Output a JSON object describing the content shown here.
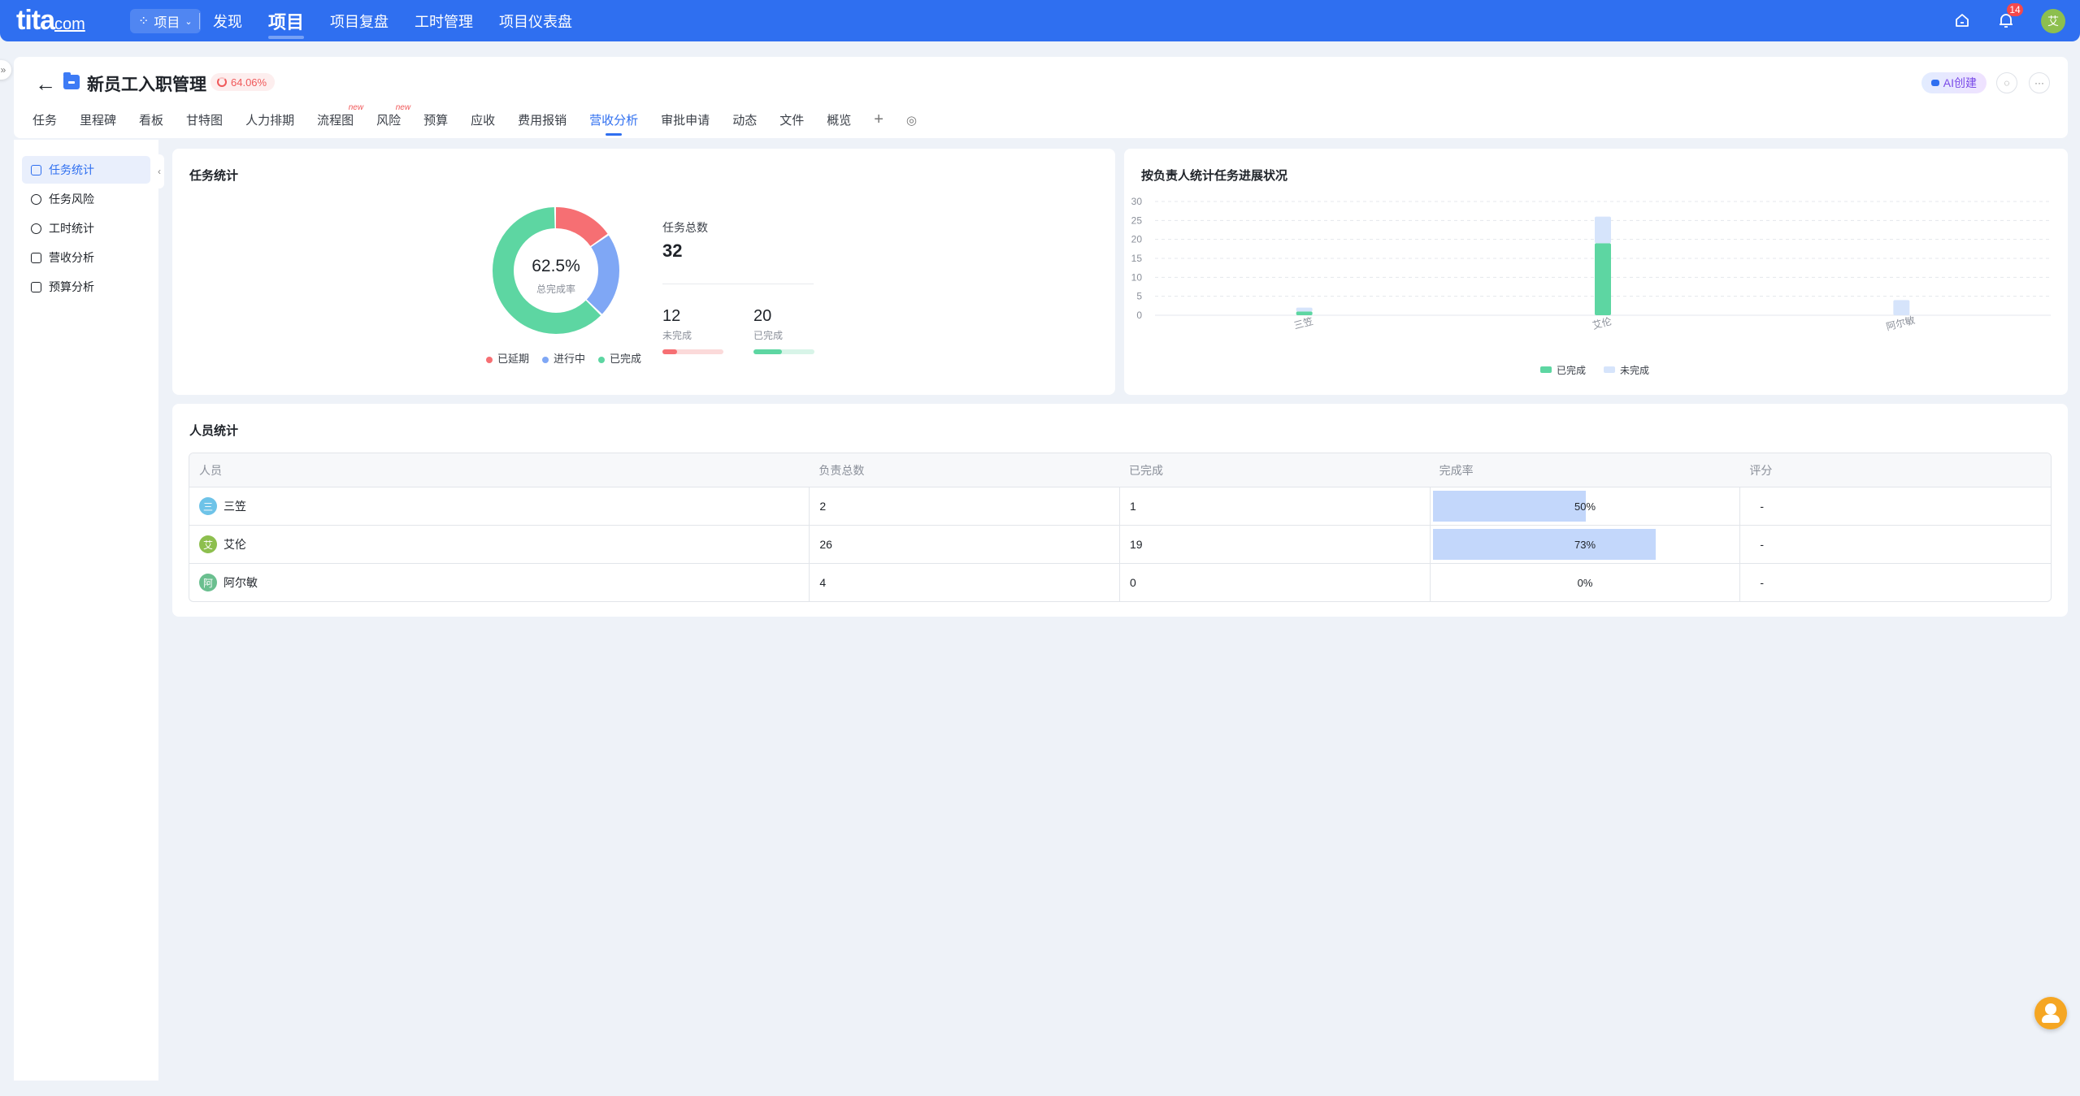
{
  "topbar": {
    "logo": "tita",
    "logo_suffix": "com",
    "project_switch": "项目",
    "nav": [
      "发现",
      "项目",
      "项目复盘",
      "工时管理",
      "项目仪表盘"
    ],
    "active_nav": "项目",
    "notification_count": "14",
    "user_avatar": "艾"
  },
  "project": {
    "title": "新员工入职管理",
    "progress": "64.06%",
    "ai_button": "AI创建",
    "tabs": [
      "任务",
      "里程碑",
      "看板",
      "甘特图",
      "人力排期",
      "流程图",
      "风险",
      "预算",
      "应收",
      "费用报销",
      "营收分析",
      "审批申请",
      "动态",
      "文件",
      "概览"
    ],
    "new_tag": "new",
    "active_tab": "营收分析"
  },
  "sidebar": {
    "items": [
      "任务统计",
      "任务风险",
      "工时统计",
      "营收分析",
      "预算分析"
    ],
    "active": "任务统计"
  },
  "task_stats": {
    "title": "任务统计",
    "completion_rate": "62.5%",
    "completion_label": "总完成率",
    "total_label": "任务总数",
    "total": "32",
    "incomplete_count": "12",
    "incomplete_label": "未完成",
    "complete_count": "20",
    "complete_label": "已完成",
    "legend": [
      "已延期",
      "进行中",
      "已完成"
    ],
    "colors": {
      "delayed": "#f66f73",
      "in_progress": "#7fa7f5",
      "done": "#5dd6a2"
    },
    "donut_segments": [
      {
        "name": "已延期",
        "value": 5
      },
      {
        "name": "进行中",
        "value": 7
      },
      {
        "name": "已完成",
        "value": 20
      }
    ]
  },
  "chart_data": {
    "type": "bar",
    "title": "按负责人统计任务进展状况",
    "categories": [
      "三笠",
      "艾伦",
      "阿尔敏"
    ],
    "series": [
      {
        "name": "已完成",
        "values": [
          1,
          19,
          0
        ],
        "color": "#5dd6a2"
      },
      {
        "name": "未完成",
        "values": [
          1,
          7,
          4
        ],
        "color": "#d6e4fb"
      }
    ],
    "stacked": true,
    "ylim": [
      0,
      30
    ],
    "yticks": [
      "0",
      "5",
      "10",
      "15",
      "20",
      "25",
      "30"
    ],
    "legend_position": "bottom",
    "grid": true
  },
  "people_stats": {
    "title": "人员统计",
    "headers": [
      "人员",
      "负责总数",
      "已完成",
      "完成率",
      "评分"
    ],
    "rows": [
      {
        "avatar": "三",
        "name": "三笠",
        "avatar_color": "#6ec3e8",
        "total": "2",
        "done": "1",
        "rate": "50%",
        "rate_value": 0.5,
        "score": "-"
      },
      {
        "avatar": "艾",
        "name": "艾伦",
        "avatar_color": "#8dbf4e",
        "total": "26",
        "done": "19",
        "rate": "73%",
        "rate_value": 0.73,
        "score": "-"
      },
      {
        "avatar": "阿",
        "name": "阿尔敏",
        "avatar_color": "#6abf8f",
        "total": "4",
        "done": "0",
        "rate": "0%",
        "rate_value": 0,
        "score": "-"
      }
    ]
  }
}
